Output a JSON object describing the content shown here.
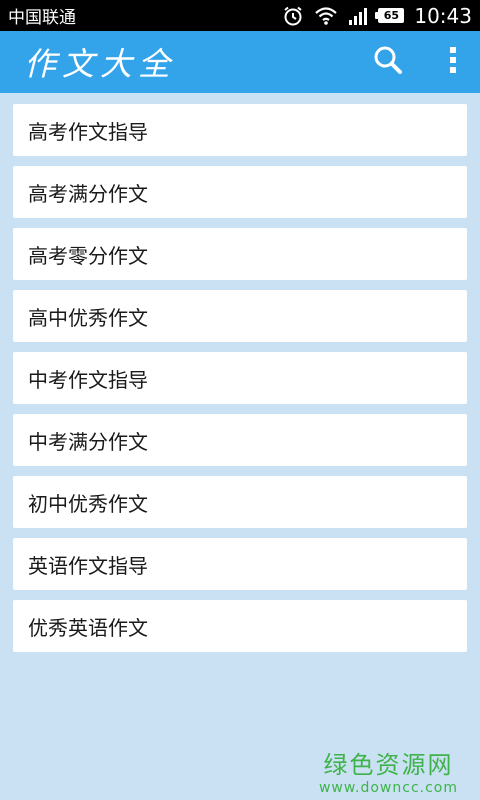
{
  "status_bar": {
    "carrier": "中国联通",
    "battery_level": "65",
    "time": "10:43",
    "icons": [
      "alarm-icon",
      "wifi-icon",
      "signal-icon",
      "battery-icon"
    ]
  },
  "action_bar": {
    "title": "作文大全",
    "color": "#34a4ea",
    "icons": [
      "search-icon",
      "overflow-menu-icon"
    ]
  },
  "categories": [
    {
      "label": "高考作文指导"
    },
    {
      "label": "高考满分作文"
    },
    {
      "label": "高考零分作文"
    },
    {
      "label": "高中优秀作文"
    },
    {
      "label": "中考作文指导"
    },
    {
      "label": "中考满分作文"
    },
    {
      "label": "初中优秀作文"
    },
    {
      "label": "英语作文指导"
    },
    {
      "label": "优秀英语作文"
    }
  ],
  "watermark": {
    "title": "绿色资源网",
    "url": "www.downcc.com",
    "color": "#3fb34a"
  },
  "theme": {
    "background": "#c9e1f3",
    "item_background": "#ffffff"
  }
}
